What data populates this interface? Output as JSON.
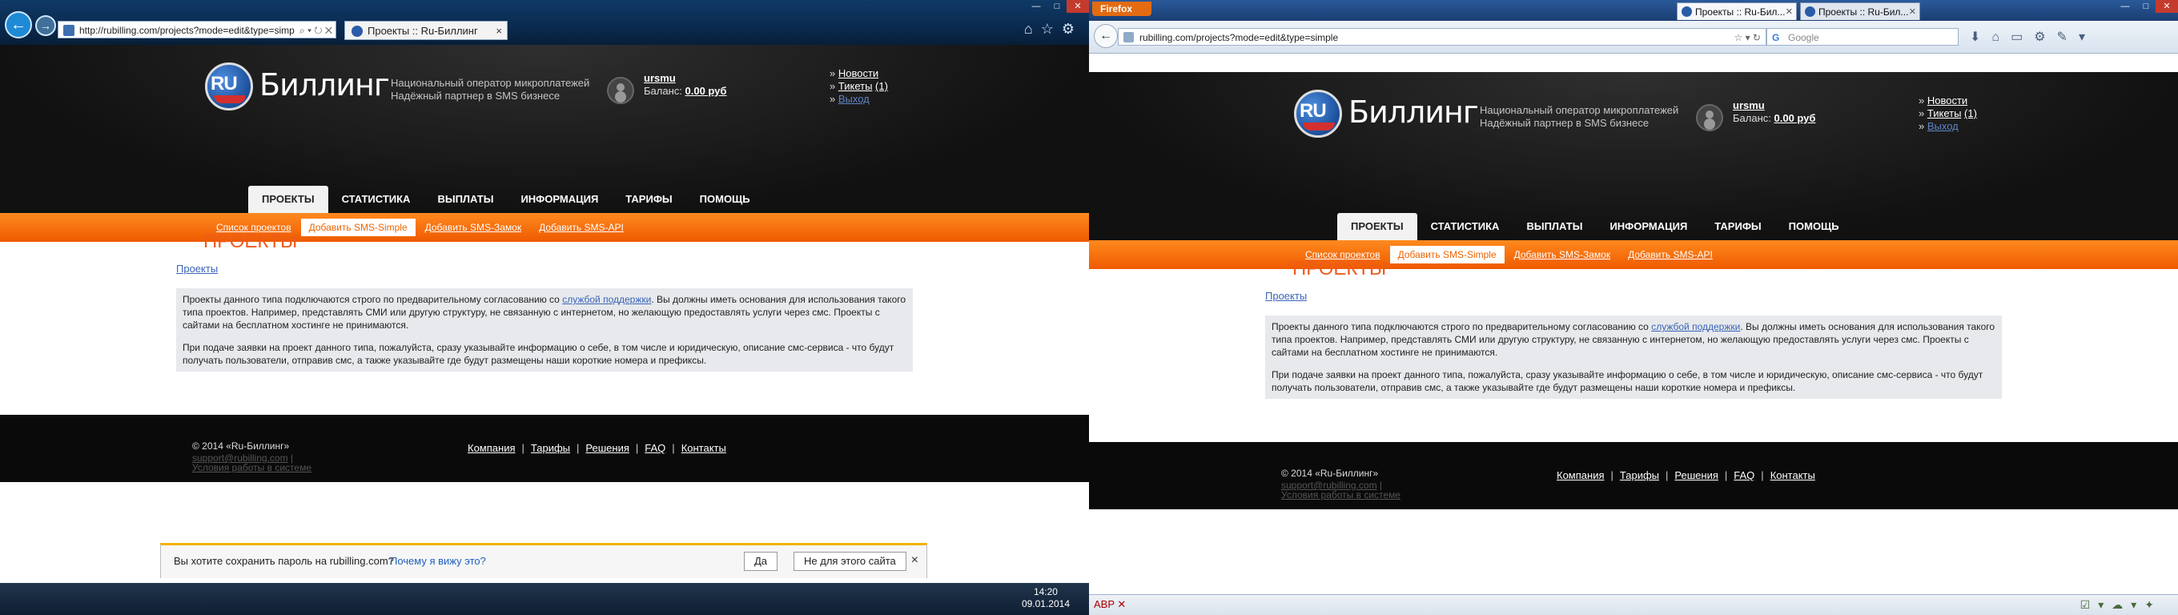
{
  "ie": {
    "url": "http://rubilling.com/projects?mode=edit&type=simp",
    "tab_title": "Проекты :: Ru-Биллинг",
    "tab_close": "×",
    "back_icon": "arrow-left",
    "forward_icon": "arrow-right",
    "save_prompt": {
      "question": "Вы хотите сохранить пароль на rubilling.com?",
      "why_link": "Почему я вижу это?",
      "yes": "Да",
      "no": "Не для этого сайта",
      "close": "×"
    },
    "taskbar": {
      "time": "14:20",
      "date": "09.01.2014"
    }
  },
  "firefox": {
    "menu_label": "Firefox",
    "tabs": [
      {
        "title": "Проекты :: Ru-Бил...",
        "active": true
      },
      {
        "title": "Проекты :: Ru-Бил...",
        "active": false
      }
    ],
    "url": "rubilling.com/projects?mode=edit&type=simple",
    "search_placeholder": "Google",
    "search_engine": "G"
  },
  "site": {
    "logo_text": "RU",
    "brand": "Биллинг",
    "tagline_1": "Национальный оператор микроплатежей",
    "tagline_2": "Надёжный партнер в SMS бизнесе",
    "username": "ursmu",
    "balance_label": "Баланс:",
    "balance_value": "0.00 руб",
    "top_links": {
      "news": "Новости",
      "tickets": "Тикеты",
      "tickets_count": "(1)",
      "logout": "Выход",
      "bullet": "»"
    },
    "nav": [
      "ПРОЕКТЫ",
      "СТАТИСТИКА",
      "ВЫПЛАТЫ",
      "ИНФОРМАЦИЯ",
      "ТАРИФЫ",
      "ПОМОЩЬ"
    ],
    "subnav": [
      "Список проектов",
      "Добавить SMS-Simple",
      "Добавить SMS-Замок",
      "Добавить SMS-API"
    ],
    "page_title": "ПРОЕКТЫ",
    "breadcrumb": "Проекты",
    "info": {
      "p1_a": "Проекты данного типа подключаются строго по предварительному согласованию со ",
      "p1_link": "службой поддержки",
      "p1_b": ". Вы должны иметь основания для использования такого типа проектов. Например, представлять СМИ или другую структуру, не связанную с интернетом, но желающую предоставлять услуги через смс. Проекты с сайтами на бесплатном хостинге не принимаются.",
      "p2": "При подаче заявки на проект данного типа, пожалуйста, сразу указывайте информацию о себе, в том числе и юридическую, описание смс-сервиса - что будут получать пользователи, отправив смс, а также указывайте где будут размещены наши короткие номера и префиксы."
    },
    "footer": {
      "copyright": "© 2014 «Ru-Биллинг»",
      "email": "support@rubilling.com",
      "terms": "Условия работы в системе",
      "links": [
        "Компания",
        "Тарифы",
        "Решения",
        "FAQ",
        "Контакты"
      ],
      "sep": "|"
    }
  },
  "colors": {
    "accent_orange": "#ee5a00",
    "title_orange": "#ef5b1b",
    "link_blue": "#3a63b8",
    "header_dark": "#111111"
  }
}
